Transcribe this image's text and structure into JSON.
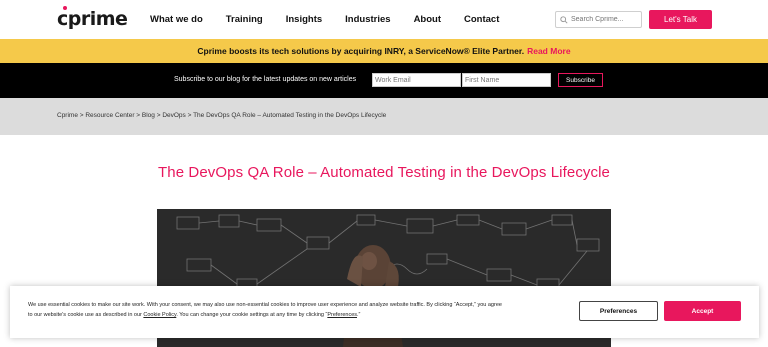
{
  "header": {
    "logo": "cprime",
    "nav": [
      "What we do",
      "Training",
      "Insights",
      "Industries",
      "About",
      "Contact"
    ],
    "search_placeholder": "Search Cprime...",
    "cta_label": "Let's Talk"
  },
  "announcement": {
    "text": "Cprime boosts its tech solutions by acquiring INRY, a ServiceNow® Elite Partner.",
    "link": "Read More"
  },
  "subscribe": {
    "text": "Subscribe to our blog for the latest updates on new articles",
    "email_placeholder": "Work Email",
    "name_placeholder": "First Name",
    "button": "Subscribe"
  },
  "breadcrumb": "Cprime > Resource Center > Blog > DevOps > The DevOps QA Role – Automated Testing in the DevOps Lifecycle",
  "article": {
    "title": "The DevOps QA Role – Automated Testing in the DevOps Lifecycle"
  },
  "cookie": {
    "line1": "We use essential cookies to make our site work. With your consent, we may also use non-essential cookies to improve user experience and analyze website traffic. By clicking “Accept,” you agree",
    "line2_pre": "to our website's cookie use as described in our ",
    "policy_link": "Cookie Policy",
    "line2_mid": ". You can change your cookie settings at any time by clicking “",
    "pref_link": "Preferences",
    "line2_post": ".”",
    "preferences_button": "Preferences",
    "accept_button": "Accept"
  },
  "colors": {
    "brand_pink": "#e8175d",
    "banner_yellow": "#f5c94a"
  }
}
